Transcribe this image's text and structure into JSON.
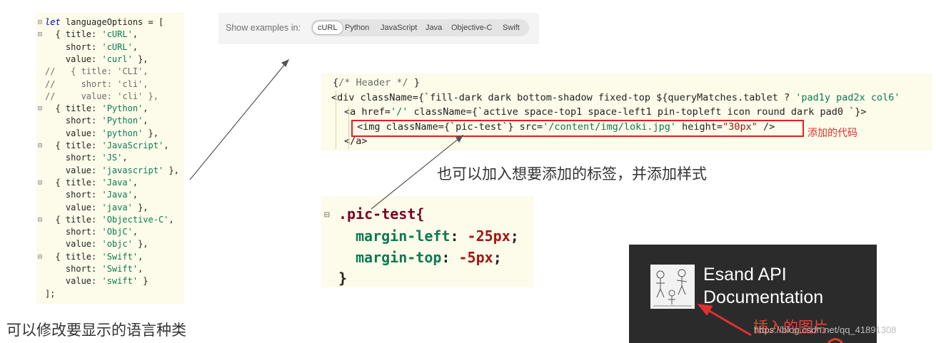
{
  "lang_code": {
    "lines": [
      {
        "fold": "⊟",
        "parts": [
          [
            "kw",
            "let"
          ],
          [
            "p",
            " languageOptions = ["
          ]
        ]
      },
      {
        "fold": "⊟",
        "parts": [
          [
            "p",
            "  { title: "
          ],
          [
            "str",
            "'cURL'"
          ],
          [
            "p",
            ","
          ]
        ]
      },
      {
        "fold": "",
        "parts": [
          [
            "p",
            "    short: "
          ],
          [
            "str",
            "'cURL'"
          ],
          [
            "p",
            ","
          ]
        ]
      },
      {
        "fold": "",
        "parts": [
          [
            "p",
            "    value: "
          ],
          [
            "str",
            "'curl'"
          ],
          [
            "p",
            " },"
          ]
        ]
      },
      {
        "fold": "",
        "parts": [
          [
            "cm",
            "//   { title: 'CLI',"
          ]
        ]
      },
      {
        "fold": "",
        "parts": [
          [
            "cm",
            "//     short: 'cli',"
          ]
        ]
      },
      {
        "fold": "",
        "parts": [
          [
            "cm",
            "//     value: 'cli' },"
          ]
        ]
      },
      {
        "fold": "⊟",
        "parts": [
          [
            "p",
            "  { title: "
          ],
          [
            "str",
            "'Python'"
          ],
          [
            "p",
            ","
          ]
        ]
      },
      {
        "fold": "",
        "parts": [
          [
            "p",
            "    short: "
          ],
          [
            "str",
            "'Python'"
          ],
          [
            "p",
            ","
          ]
        ]
      },
      {
        "fold": "",
        "parts": [
          [
            "p",
            "    value: "
          ],
          [
            "str",
            "'python'"
          ],
          [
            "p",
            " },"
          ]
        ]
      },
      {
        "fold": "⊟",
        "parts": [
          [
            "p",
            "  { title: "
          ],
          [
            "str",
            "'JavaScript'"
          ],
          [
            "p",
            ","
          ]
        ]
      },
      {
        "fold": "",
        "parts": [
          [
            "p",
            "    short: "
          ],
          [
            "str",
            "'JS'"
          ],
          [
            "p",
            ","
          ]
        ]
      },
      {
        "fold": "",
        "parts": [
          [
            "p",
            "    value: "
          ],
          [
            "str",
            "'javascript'"
          ],
          [
            "p",
            " },"
          ]
        ]
      },
      {
        "fold": "⊟",
        "parts": [
          [
            "p",
            "  { title: "
          ],
          [
            "str",
            "'Java'"
          ],
          [
            "p",
            ","
          ]
        ]
      },
      {
        "fold": "",
        "parts": [
          [
            "p",
            "    short: "
          ],
          [
            "str",
            "'Java'"
          ],
          [
            "p",
            ","
          ]
        ]
      },
      {
        "fold": "",
        "parts": [
          [
            "p",
            "    value: "
          ],
          [
            "str",
            "'java'"
          ],
          [
            "p",
            " },"
          ]
        ]
      },
      {
        "fold": "⊟",
        "parts": [
          [
            "p",
            "  { title: "
          ],
          [
            "str",
            "'Objective-C'"
          ],
          [
            "p",
            ","
          ]
        ]
      },
      {
        "fold": "",
        "parts": [
          [
            "p",
            "    short: "
          ],
          [
            "str",
            "'ObjC'"
          ],
          [
            "p",
            ","
          ]
        ]
      },
      {
        "fold": "",
        "parts": [
          [
            "p",
            "    value: "
          ],
          [
            "str",
            "'objc'"
          ],
          [
            "p",
            " },"
          ]
        ]
      },
      {
        "fold": "⊟",
        "parts": [
          [
            "p",
            "  { title: "
          ],
          [
            "str",
            "'Swift'"
          ],
          [
            "p",
            ","
          ]
        ]
      },
      {
        "fold": "",
        "parts": [
          [
            "p",
            "    short: "
          ],
          [
            "str",
            "'Swift'"
          ],
          [
            "p",
            ","
          ]
        ]
      },
      {
        "fold": "",
        "parts": [
          [
            "p",
            "    value: "
          ],
          [
            "str",
            "'swift'"
          ],
          [
            "p",
            " }"
          ]
        ]
      },
      {
        "fold": "",
        "parts": [
          [
            "p",
            "];"
          ]
        ]
      }
    ]
  },
  "examples": {
    "label": "Show examples in:",
    "options": [
      "cURL",
      "Python",
      "JavaScript",
      "Java",
      "Objective-C",
      "Swift"
    ],
    "selected": "cURL"
  },
  "jsx_code": {
    "lines": [
      {
        "parts": [
          [
            "p",
            "{"
          ],
          [
            "cm",
            "/* Header */"
          ],
          [
            "p",
            " }"
          ]
        ]
      },
      {
        "parts": [
          [
            "p",
            "<div className={`fill-dark dark bottom-shadow fixed-top "
          ],
          [
            "p",
            "${queryMatches.tablet ? "
          ],
          [
            "str",
            "'pad1y pad2x col6'"
          ]
        ]
      },
      {
        "parts": [
          [
            "p",
            "<a href="
          ],
          [
            "str",
            "'/'"
          ],
          [
            "p",
            " className={`active space-top1 space-left1 pin-topleft icon round dark pad0 `}>"
          ]
        ]
      },
      {
        "parts": [
          [
            "p",
            "<img className={`pic-test`} src="
          ],
          [
            "str",
            "'/content/img/loki.jpg'"
          ],
          [
            "p",
            " height="
          ],
          [
            "kw",
            "\"30px\""
          ],
          [
            "p",
            " />"
          ]
        ]
      },
      {
        "parts": [
          [
            "p",
            "</a>"
          ]
        ]
      }
    ],
    "added_label": "添加的代码"
  },
  "caption_tags": "也可以加入想要添加的标签，并添加样式",
  "caption_langs": "可以修改要显示的语言种类",
  "css_code": {
    "selector": ".pic-test{",
    "rules": [
      {
        "prop": "margin-left",
        "val": "-25px"
      },
      {
        "prop": "margin-top",
        "val": "-5px"
      }
    ],
    "close": "}"
  },
  "doc_header": {
    "title_line1": "Esand API",
    "title_line2": "Documentation",
    "note": "插入的图片"
  },
  "watermark": "https://blog.csdn.net/qq_41891308",
  "colors": {
    "red": "#e02020",
    "string": "#0b7a56",
    "code_bg": "#fdfbe9"
  }
}
